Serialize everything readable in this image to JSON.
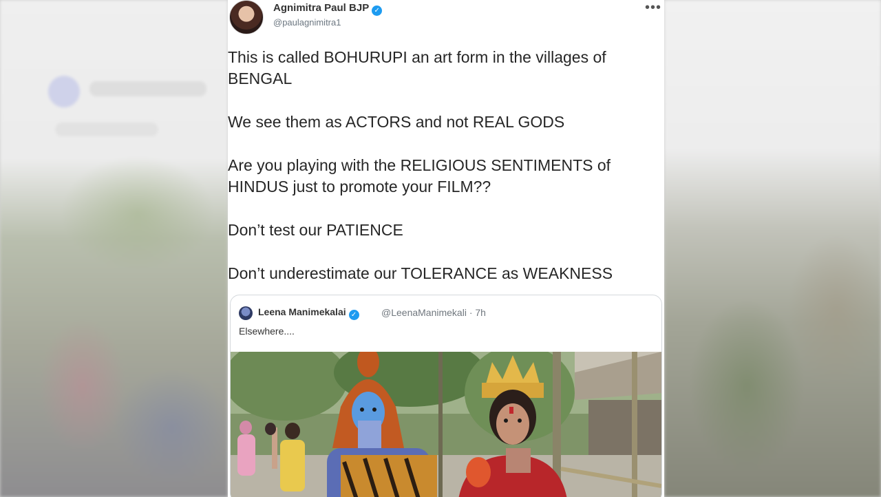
{
  "tweet": {
    "display_name": "Agnimitra Paul BJP",
    "handle": "@paulagnimitra1",
    "more_icon": "more-horizontal-icon",
    "paragraphs": [
      "This is called BOHURUPI an art form in the villages of BENGAL",
      "We see them as ACTORS and not REAL GODS",
      "Are you playing with the RELIGIOUS SENTIMENTS of HINDUS just to promote your FILM??",
      "Don’t test our PATIENCE",
      "Don’t underestimate our TOLERANCE as WEAKNESS"
    ]
  },
  "quote": {
    "display_name": "Leena Manimekalai",
    "handle_time": "@LeenaManimekali · 7h",
    "text": "Elsewhere....",
    "photo_icon": "photo-image"
  },
  "colors": {
    "verified": "#1d9bf0",
    "card_bg": "#ffffff",
    "text": "#262626"
  }
}
